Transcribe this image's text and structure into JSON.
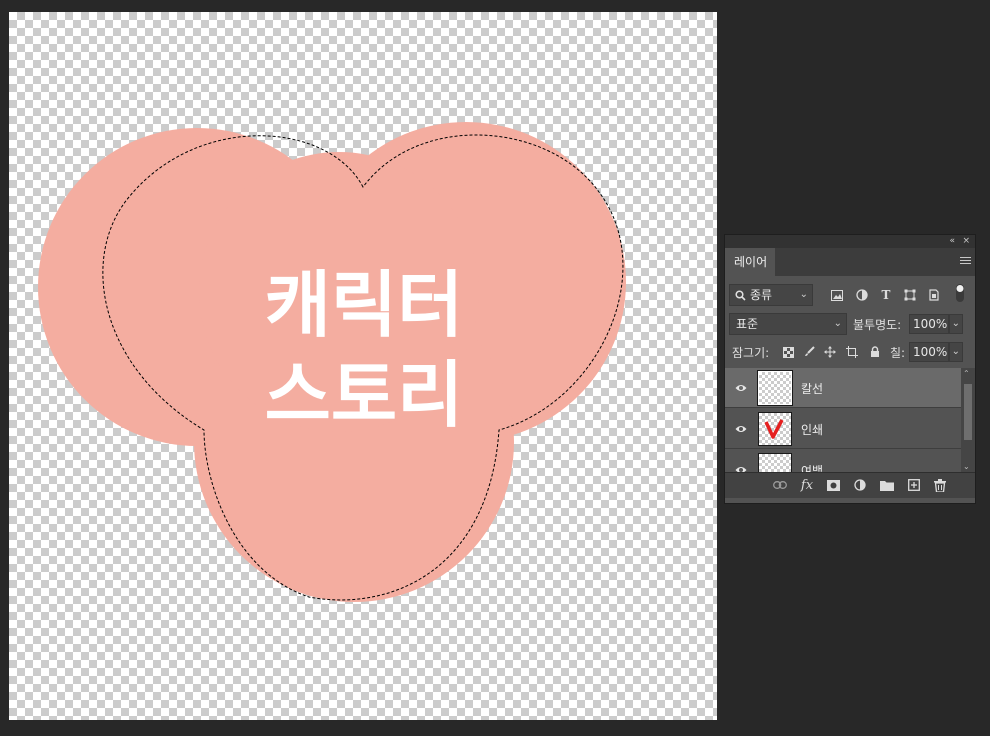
{
  "canvas": {
    "text_line1": "캐릭터",
    "text_line2": "스토리",
    "shape_color": "#f4ada0"
  },
  "layers_panel": {
    "collapse_glyph": "«",
    "close_glyph": "×",
    "tab_label": "레이어",
    "filter_kind": "종류",
    "blend_mode": "표준",
    "opacity_label": "불투명도:",
    "opacity_value": "100%",
    "lock_label": "잠그기:",
    "fill_label": "칠:",
    "fill_value": "100%",
    "layers": [
      {
        "name": "칼선",
        "visible": true,
        "selected": true,
        "thumbnail": "empty"
      },
      {
        "name": "인쇄",
        "visible": true,
        "selected": false,
        "thumbnail": "red-check"
      },
      {
        "name": "여백",
        "visible": true,
        "selected": false,
        "thumbnail": "empty"
      }
    ]
  }
}
